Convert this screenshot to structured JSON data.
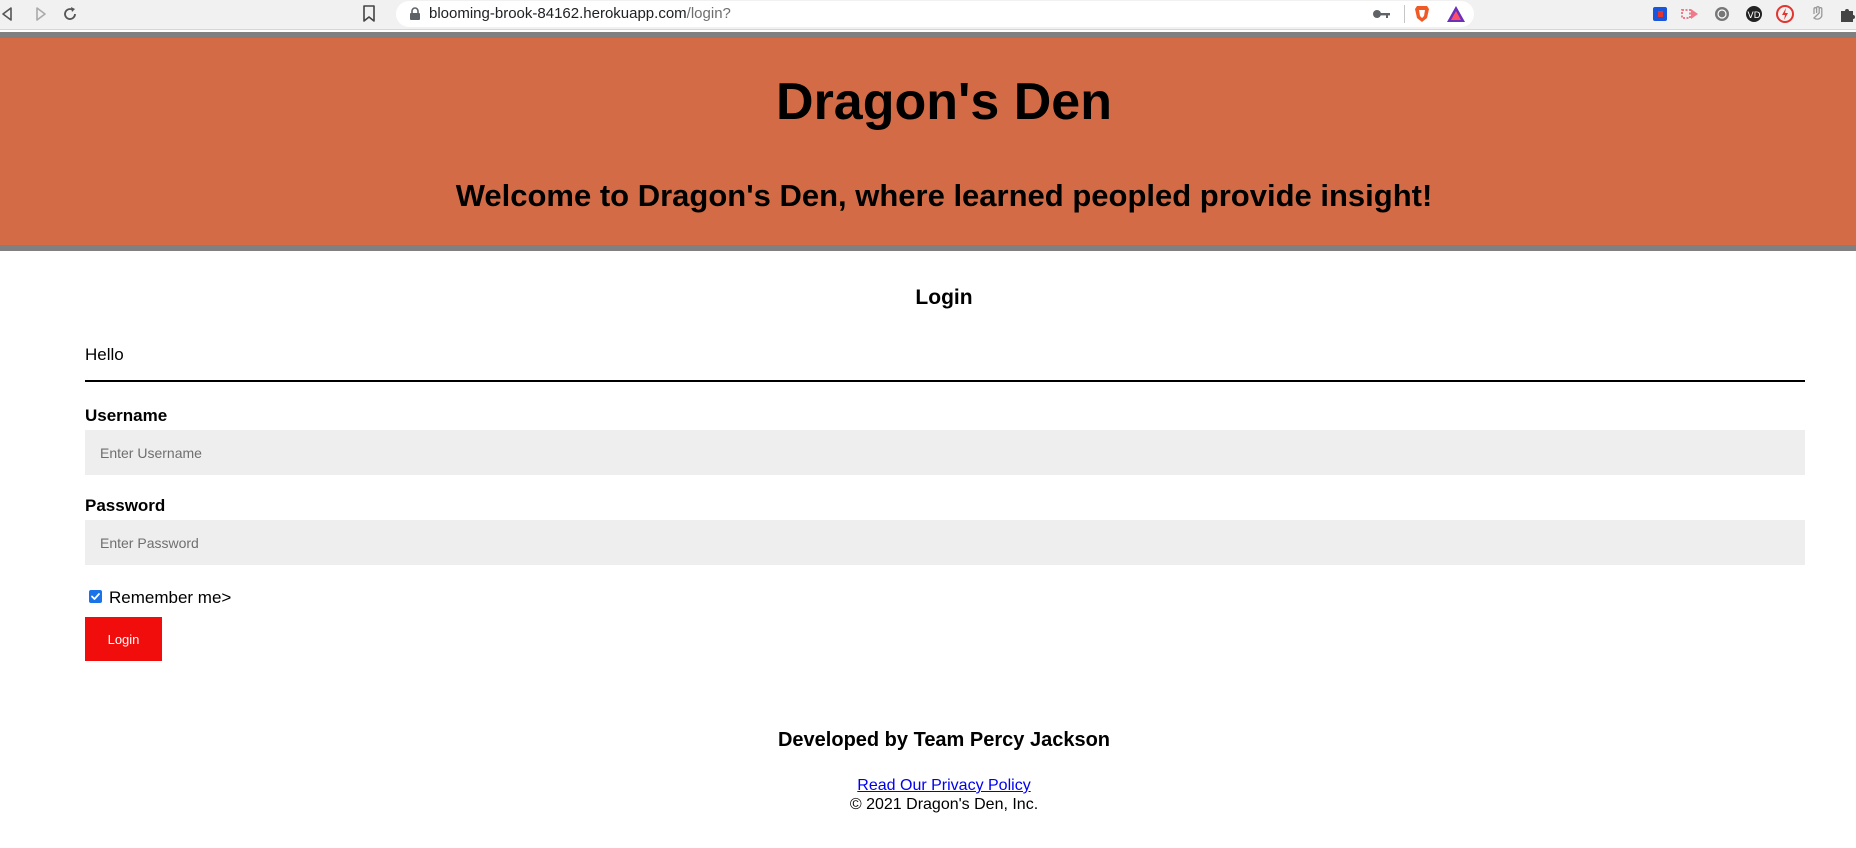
{
  "browser": {
    "url_host": "blooming-brook-84162.herokuapp.com",
    "url_path": "/login?"
  },
  "header": {
    "title": "Dragon's Den",
    "tagline": "Welcome to Dragon's Den, where learned peopled provide insight!",
    "background_color": "#d36c46",
    "border_color": "#808080"
  },
  "login": {
    "heading": "Login",
    "greeting": "Hello",
    "username_label": "Username",
    "username_placeholder": "Enter Username",
    "username_value": "",
    "password_label": "Password",
    "password_placeholder": "Enter Password",
    "password_value": "",
    "remember_label": "Remember me>",
    "remember_checked": true,
    "submit_label": "Login",
    "submit_color": "#f20d0d"
  },
  "footer": {
    "credit": "Developed by Team Percy Jackson",
    "privacy_link": "Read Our Privacy Policy",
    "copyright": "© 2021 Dragon's Den, Inc."
  }
}
